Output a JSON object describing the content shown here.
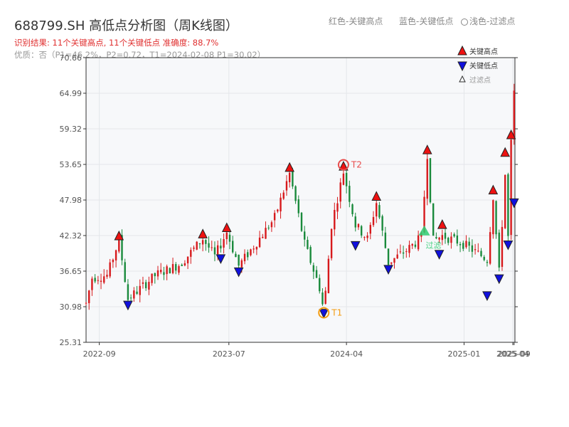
{
  "header": {
    "title": "688799.SH 高低点分析图（周K线图）",
    "result": "识别结果: 11个关键高点, 11个关键低点   准确度: 88.7%",
    "quality": "优质：否（P1=46.2%，P2=0.72，T1=2024-02-08 P1=30.02）",
    "legend_red": "红色-关键高点",
    "legend_blue": "蓝色-关键低点",
    "legend_filtered": "浅色-过滤点"
  },
  "colors": {
    "up": "#d7191c",
    "down": "#1a8a3c",
    "high_marker": "#ee1111",
    "low_marker": "#1010dd",
    "t1": "#f39c12",
    "t2": "#e84c4c",
    "filtered": "#2ecc71",
    "plot_bg": "#f7f8fa",
    "grid": "#e4e6ea"
  },
  "chart_data": {
    "type": "candlestick",
    "y_ticks": [
      "25.31",
      "30.98",
      "36.65",
      "42.32",
      "47.98",
      "53.65",
      "59.32",
      "64.99",
      "70.66"
    ],
    "ylim": [
      25.31,
      70.66
    ],
    "x_start": "2022-08-01",
    "x_end": "2025-04-30",
    "x_ticks": [
      {
        "date": "2022-09-01",
        "label": "2022-09"
      },
      {
        "date": "2023-07-01",
        "label": "2023-07"
      },
      {
        "date": "2024-04-01",
        "label": "2024-04"
      },
      {
        "date": "2025-01-01",
        "label": "2025-01"
      },
      {
        "date": "2025-04-25",
        "label": "2025-04"
      },
      {
        "date": "2025-04-28",
        "label": "2025-09"
      }
    ],
    "legend": [
      {
        "label": "关键高点",
        "marker": "triangle-up"
      },
      {
        "label": "关键低点",
        "marker": "triangle-down"
      },
      {
        "label": "过滤点",
        "marker": "triangle-up-hollow"
      }
    ],
    "anchors": [
      {
        "date": "2022-08-01",
        "price": 31.5
      },
      {
        "date": "2022-08-15",
        "price": 35.6
      },
      {
        "date": "2022-09-20",
        "price": 36.0
      },
      {
        "date": "2022-10-17",
        "price": 41.7
      },
      {
        "date": "2022-11-07",
        "price": 32.2
      },
      {
        "date": "2023-01-10",
        "price": 36.0
      },
      {
        "date": "2023-03-10",
        "price": 37.8
      },
      {
        "date": "2023-05-01",
        "price": 41.8
      },
      {
        "date": "2023-05-29",
        "price": 39.0
      },
      {
        "date": "2023-06-26",
        "price": 42.9
      },
      {
        "date": "2023-07-24",
        "price": 37.5
      },
      {
        "date": "2023-09-01",
        "price": 41.0
      },
      {
        "date": "2023-10-15",
        "price": 45.0
      },
      {
        "date": "2023-11-20",
        "price": 52.2
      },
      {
        "date": "2023-12-25",
        "price": 41.0
      },
      {
        "date": "2024-01-29",
        "price": 34.0
      },
      {
        "date": "2024-02-08",
        "price": 30.2
      },
      {
        "date": "2024-02-26",
        "price": 44.0
      },
      {
        "date": "2024-03-25",
        "price": 52.5
      },
      {
        "date": "2024-04-22",
        "price": 44.0
      },
      {
        "date": "2024-05-20",
        "price": 41.8
      },
      {
        "date": "2024-06-10",
        "price": 47.6
      },
      {
        "date": "2024-07-08",
        "price": 38.0
      },
      {
        "date": "2024-08-20",
        "price": 40.0
      },
      {
        "date": "2024-09-23",
        "price": 42.0
      },
      {
        "date": "2024-10-07",
        "price": 55.3
      },
      {
        "date": "2024-10-21",
        "price": 41.5
      },
      {
        "date": "2024-11-11",
        "price": 42.3
      },
      {
        "date": "2024-12-30",
        "price": 41.0
      },
      {
        "date": "2025-02-24",
        "price": 38.5
      },
      {
        "date": "2025-03-10",
        "price": 48.5
      },
      {
        "date": "2025-03-24",
        "price": 36.5
      },
      {
        "date": "2025-04-07",
        "price": 52.0
      },
      {
        "date": "2025-04-14",
        "price": 42.0
      },
      {
        "date": "2025-04-21",
        "price": 57.0
      },
      {
        "date": "2025-04-24",
        "price": 48.0
      },
      {
        "date": "2025-04-28",
        "price": 65.0
      }
    ],
    "key_highs": [
      {
        "date": "2022-10-17",
        "price": 42.2
      },
      {
        "date": "2023-05-01",
        "price": 42.5
      },
      {
        "date": "2023-06-26",
        "price": 43.5
      },
      {
        "date": "2023-11-20",
        "price": 53.1
      },
      {
        "date": "2024-03-25",
        "price": 53.3
      },
      {
        "date": "2024-06-10",
        "price": 48.5
      },
      {
        "date": "2024-10-07",
        "price": 55.9
      },
      {
        "date": "2024-11-11",
        "price": 44.0
      },
      {
        "date": "2025-03-10",
        "price": 49.5
      },
      {
        "date": "2025-04-07",
        "price": 55.5
      },
      {
        "date": "2025-04-21",
        "price": 58.3
      }
    ],
    "key_lows": [
      {
        "date": "2022-11-07",
        "price": 31.3
      },
      {
        "date": "2023-06-12",
        "price": 38.7
      },
      {
        "date": "2023-07-24",
        "price": 36.6
      },
      {
        "date": "2024-02-08",
        "price": 30.0
      },
      {
        "date": "2024-04-22",
        "price": 40.8
      },
      {
        "date": "2024-07-08",
        "price": 37.0
      },
      {
        "date": "2024-11-04",
        "price": 39.4
      },
      {
        "date": "2025-02-24",
        "price": 32.8
      },
      {
        "date": "2025-03-24",
        "price": 35.5
      },
      {
        "date": "2025-04-14",
        "price": 40.9
      },
      {
        "date": "2025-04-28",
        "price": 47.6
      }
    ],
    "t1": {
      "date": "2024-02-08",
      "price": 30.02,
      "label": "T1"
    },
    "t2": {
      "date": "2024-03-25",
      "price": 53.6,
      "label": "T2"
    },
    "filtered": [
      {
        "date": "2024-09-30",
        "price": 42.8,
        "label": "过滤"
      }
    ]
  }
}
